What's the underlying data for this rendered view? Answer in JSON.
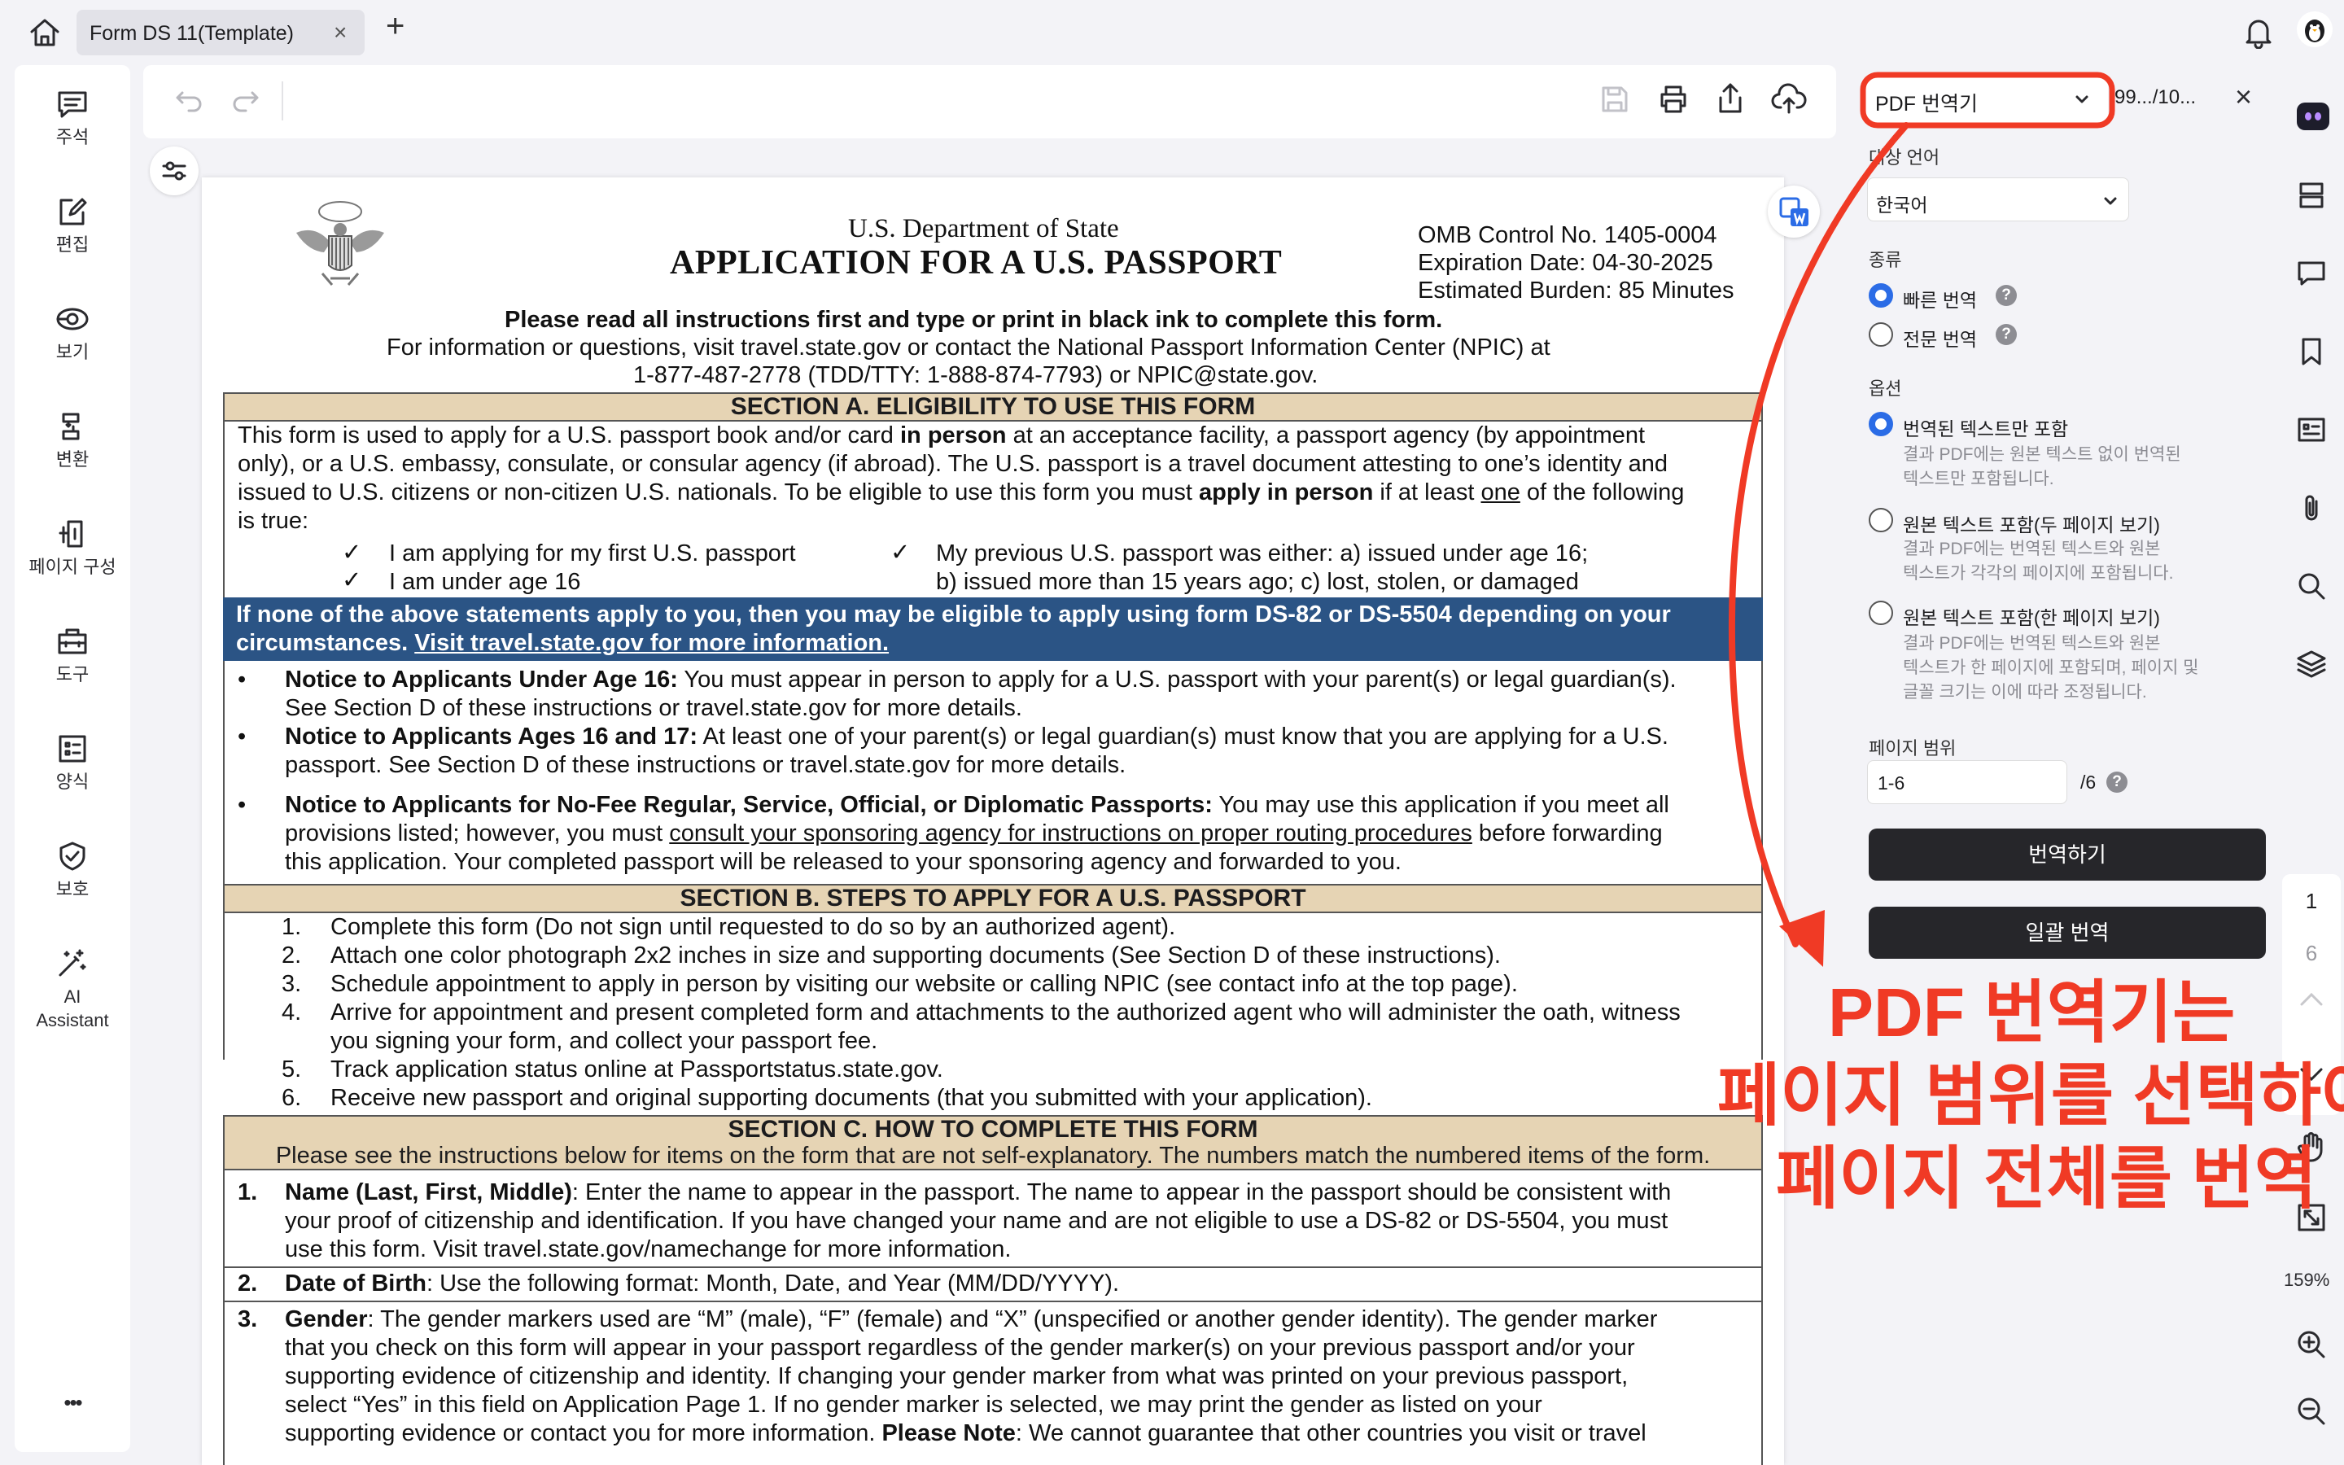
{
  "tab": {
    "title": "Form DS 11(Template)",
    "close": "×",
    "new_tab": "+"
  },
  "sidebar": {
    "items": [
      {
        "label": "주석",
        "icon": "comment-icon"
      },
      {
        "label": "편집",
        "icon": "edit-icon"
      },
      {
        "label": "보기",
        "icon": "view-icon"
      },
      {
        "label": "변환",
        "icon": "convert-icon"
      },
      {
        "label": "페이지 구성",
        "icon": "page-organize-icon"
      },
      {
        "label": "도구",
        "icon": "tools-icon"
      },
      {
        "label": "양식",
        "icon": "form-icon"
      },
      {
        "label": "보호",
        "icon": "protect-icon"
      },
      {
        "label": "AI Assistant",
        "icon": "ai-wand-icon"
      }
    ],
    "more": "•••"
  },
  "document": {
    "header": {
      "dept": "U.S. Department of State",
      "title": "APPLICATION FOR A U.S. PASSPORT",
      "omb": "OMB Control No. 1405-0004",
      "expiration": "Expiration Date: 04-30-2025",
      "burden": "Estimated Burden: 85 Minutes",
      "instr1": "Please read all instructions first and type or print in black ink to complete this form.",
      "instr2": "For information or questions, visit travel.state.gov or contact the National Passport Information Center (NPIC) at",
      "instr3": "1-877-487-2778  (TDD/TTY: 1-888-874-7793) or NPIC@state.gov."
    },
    "section_a": {
      "title": "SECTION A. ELIGIBILITY TO USE THIS FORM",
      "l1a": "This form is used to apply for a U.S. passport book and/or card ",
      "l1b": "in person",
      "l1c": " at an acceptance facility, a passport agency (by appointment",
      "l2": "only), or a U.S. embassy, consulate, or consular agency (if abroad). The U.S. passport is a travel document attesting to one’s identity and",
      "l3a": "issued to U.S. citizens or non-citizen U.S. nationals. To be eligible to use this form you must ",
      "l3b": "apply in person",
      "l3c": " if at least ",
      "l3d": "one",
      "l3e": " of the following",
      "l4": "is true:",
      "check": "✓",
      "c1": "I am applying for my first U.S. passport",
      "c2": "I am under age 16",
      "c3": "My previous U.S. passport was either: a) issued under age 16;",
      "c4": "b) issued more than 15 years ago; c) lost, stolen, or damaged",
      "blue1": "If none of the above statements apply to you, then you may be eligible to apply using form DS-82 or DS-5504 depending on your",
      "blue2a": "circumstances. ",
      "blue2b": "Visit travel.state.gov for more information.",
      "bullet": "•",
      "n1b": "Notice to Applicants Under Age 16:",
      "n1": " You must appear in person to apply for a U.S. passport with your parent(s) or legal guardian(s).",
      "n1c": "See Section D of these instructions or travel.state.gov for more details.",
      "n2b": "Notice to Applicants Ages 16 and 17:",
      "n2": " At least one of your parent(s) or legal guardian(s) must know that you are applying for a U.S.",
      "n2c": "passport. See Section D of these instructions or travel.state.gov for more details.",
      "n3b": "Notice to Applicants for No-Fee Regular, Service, Official, or Diplomatic Passports:",
      "n3": " You may use this application if you meet all",
      "n3c": "provisions listed; however, you must ",
      "n3d": "consult your sponsoring agency for instructions on proper routing procedures",
      "n3e": " before forwarding",
      "n3f": "this application. Your completed passport will be released to your sponsoring agency and forwarded to you."
    },
    "section_b": {
      "title": "SECTION B. STEPS TO APPLY FOR A U.S. PASSPORT",
      "steps": [
        {
          "n": "1.",
          "t": "Complete this form (Do not sign until requested to do so by an authorized agent)."
        },
        {
          "n": "2.",
          "t": "Attach one color photograph 2x2 inches in size and supporting documents (See Section D of these instructions)."
        },
        {
          "n": "3.",
          "t": "Schedule appointment to apply in person by visiting our website or calling NPIC (see contact info at the top page)."
        },
        {
          "n": "4.",
          "t": "Arrive for appointment and present completed form and attachments to the authorized agent who will administer the oath, witness"
        },
        {
          "n": "",
          "t": "you signing your form, and collect your passport fee."
        },
        {
          "n": "5.",
          "t": "Track application status online at Passportstatus.state.gov."
        },
        {
          "n": "6.",
          "t": "Receive new passport and original supporting documents (that you submitted with your application)."
        }
      ]
    },
    "section_c": {
      "title": "SECTION C. HOW TO COMPLETE THIS FORM",
      "intro": "Please see the instructions below for items on the form that are not self-explanatory. The numbers match the numbered items of the form.",
      "i1n": "1.",
      "i1b": "Name (Last, First, Middle)",
      "i1": ": Enter the name to appear in the passport. The name to appear in the passport should be consistent with",
      "i1c": "your proof of citizenship and identification. If you have changed your name and are not eligible to use a DS-82 or DS-5504, you must",
      "i1d": "use this form. Visit travel.state.gov/namechange for more information.",
      "i2n": "2.",
      "i2b": "Date of Birth",
      "i2": ": Use the following format: Month, Date, and Year (MM/DD/YYYY).",
      "i3n": "3.",
      "i3b": "Gender",
      "i3": ": The gender markers used are “M” (male), “F” (female) and “X” (unspecified or another gender identity). The gender marker",
      "i3c": "that you check on this form will appear in your passport regardless of the gender marker(s) on your previous passport and/or your",
      "i3d": "supporting evidence of citizenship and identity. If changing your gender marker from what was printed on your previous passport,",
      "i3e": "select “Yes” in this field on Application Page 1. If no gender marker is selected, we may print the gender as listed on your",
      "i3f": "supporting evidence or contact you for more information. ",
      "i3g": "Please Note",
      "i3h": ": We cannot guarantee that other countries you visit or travel"
    }
  },
  "translator": {
    "tool_select": "PDF 번역기",
    "page_indicator": "99.../10...",
    "close": "×",
    "target_lang_label": "대상 언어",
    "target_lang": "한국어",
    "type_label": "종류",
    "type_options": [
      {
        "label": "빠른 번역",
        "selected": true
      },
      {
        "label": "전문 번역",
        "selected": false
      }
    ],
    "options_label": "옵션",
    "options": [
      {
        "label": "번역된 텍스트만 포함",
        "desc1": "결과 PDF에는 원본 텍스트 없이 번역된",
        "desc2": "텍스트만 포함됩니다.",
        "desc3": "",
        "selected": true
      },
      {
        "label": "원본 텍스트 포함(두 페이지 보기)",
        "desc1": "결과 PDF에는 번역된 텍스트와 원본",
        "desc2": "텍스트가 각각의 페이지에 포함됩니다.",
        "desc3": "",
        "selected": false
      },
      {
        "label": "원본 텍스트 포함(한 페이지 보기)",
        "desc1": "결과 PDF에는 번역된 텍스트와 원본",
        "desc2": "텍스트가 한 페이지에 포함되며, 페이지 및",
        "desc3": "글꼴 크기는 이에 따라 조정됩니다.",
        "selected": false
      }
    ],
    "page_range_label": "페이지 범위",
    "page_range_value": "1-6",
    "page_total": "/6",
    "help": "?",
    "translate_button": "번역하기",
    "batch_button": "일괄 번역"
  },
  "navigation": {
    "current_page": "1",
    "total_pages": "6",
    "zoom": "159%"
  },
  "annotation": {
    "line1": "PDF 번역기는",
    "line2": "페이지 범위를 선택하여",
    "line3": "페이지 전체를 번역",
    "color": "#f03a25"
  }
}
